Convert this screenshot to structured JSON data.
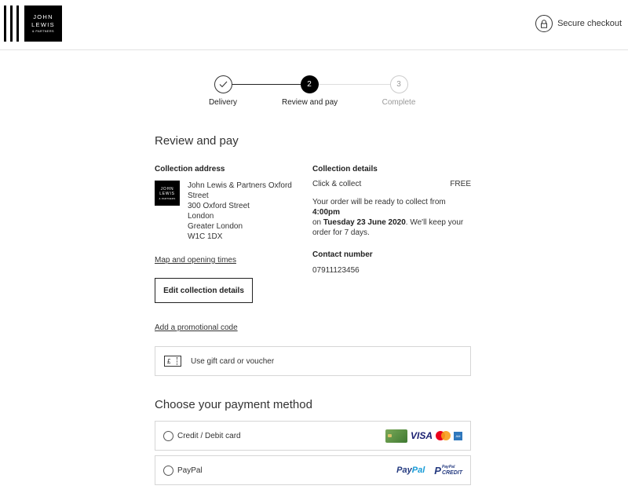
{
  "header": {
    "logo_line1": "JOHN",
    "logo_line2": "LEWIS",
    "logo_line3": "& PARTNERS",
    "secure_label": "Secure checkout",
    "secure_icon": "lock-icon"
  },
  "stepper": {
    "steps": [
      {
        "label": "Delivery",
        "state": "done",
        "marker": "✓"
      },
      {
        "label": "Review and pay",
        "state": "current",
        "marker": "2"
      },
      {
        "label": "Complete",
        "state": "todo",
        "marker": "3"
      }
    ]
  },
  "main": {
    "title": "Review and pay",
    "collection_address": {
      "heading": "Collection address",
      "lines": [
        "John Lewis & Partners Oxford",
        "Street",
        "300 Oxford Street",
        "London",
        "Greater London",
        "W1C 1DX"
      ],
      "map_link": "Map and opening times"
    },
    "collection_details": {
      "heading": "Collection details",
      "method": "Click & collect",
      "price": "FREE",
      "ready_prefix": "Your order will be ready to collect from ",
      "ready_time": "4:00pm",
      "ready_on": "on ",
      "ready_date": "Tuesday 23 June 2020",
      "ready_suffix": ". We'll keep your order for 7 days.",
      "contact_heading": "Contact number",
      "contact_number": "07911123456"
    },
    "edit_button": "Edit collection details",
    "promo_link": "Add a promotional code",
    "gift_card": {
      "label": "Use gift card or voucher",
      "icon_symbol": "£"
    }
  },
  "payment": {
    "title": "Choose your payment method",
    "options": [
      {
        "label": "Credit / Debit card",
        "logos": [
          "card",
          "VISA",
          "mastercard",
          "amex"
        ]
      },
      {
        "label": "PayPal",
        "logos": [
          "PayPal",
          "PayPal CREDIT"
        ]
      }
    ],
    "paypal_logo_a": "Pay",
    "paypal_logo_b": "Pal",
    "paypal_credit_small": "PayPal",
    "paypal_credit_big": "CREDIT",
    "visa_text": "VISA",
    "amex_text": "AM"
  },
  "colors": {
    "brand": "#000000",
    "text": "#222222",
    "border": "#d6d6d6",
    "visa_blue": "#1a1f71",
    "paypal_dark": "#253b80",
    "paypal_light": "#179bd7"
  }
}
